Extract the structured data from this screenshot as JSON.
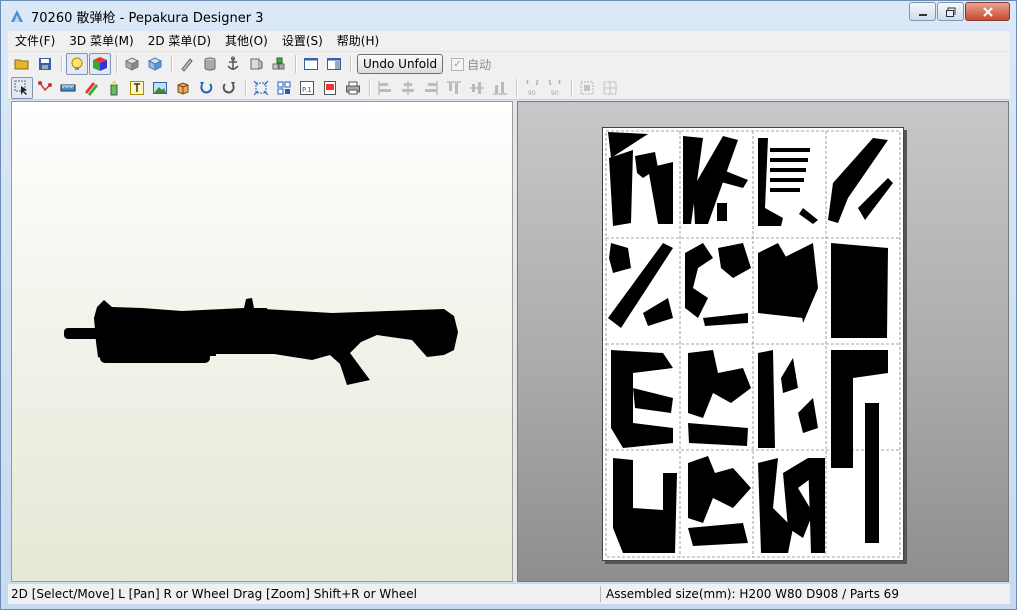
{
  "window": {
    "title": "70260 散弹枪 - Pepakura Designer 3"
  },
  "menu": [
    "文件(F)",
    "3D 菜单(M)",
    "2D 菜单(D)",
    "其他(O)",
    "设置(S)",
    "帮助(H)"
  ],
  "toolbar": {
    "undo_unfold_label": "Undo Unfold",
    "auto_label": "自动",
    "page_label": "P.1",
    "rotate_90_label": "90"
  },
  "status": {
    "left": "2D [Select/Move] L [Pan] R or Wheel Drag [Zoom] Shift+R or Wheel",
    "right": "Assembled size(mm): H200 W80 D908 / Parts 69"
  },
  "colors": {
    "model": "#000000",
    "paper": "#ffffff",
    "frame": "#c7daf0",
    "accent": "#7d94b6"
  }
}
